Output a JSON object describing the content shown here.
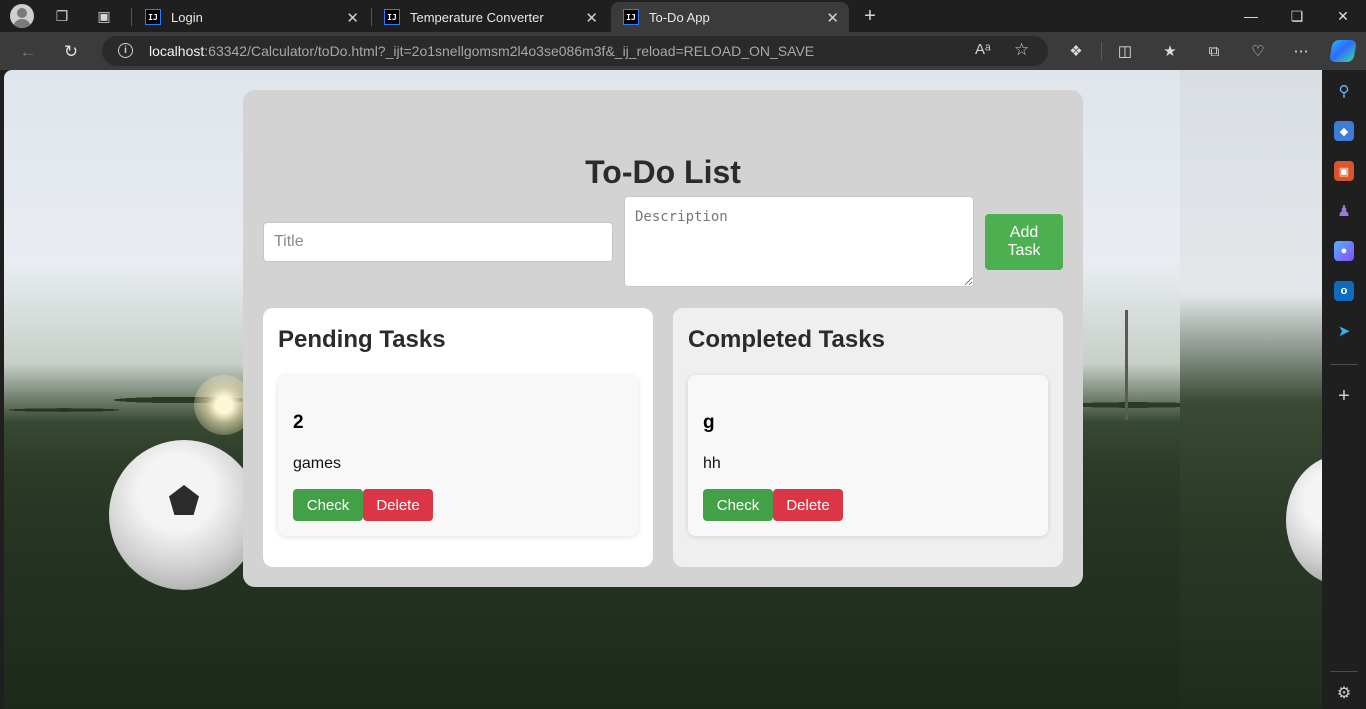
{
  "browser": {
    "tabs": [
      {
        "label": "Login",
        "favicon": "IJ",
        "active": false
      },
      {
        "label": "Temperature Converter",
        "favicon": "IJ",
        "active": false
      },
      {
        "label": "To-Do App",
        "favicon": "IJ",
        "active": true
      }
    ],
    "url_host": "localhost",
    "url_rest": ":63342/Calculator/toDo.html?_ijt=2o1snellgomsm2l4o3se086m3f&_ij_reload=RELOAD_ON_SAVE",
    "read_aloud_icon": "Aᵃ",
    "accent_color": "#2e7bff"
  },
  "app": {
    "title": "To-Do List",
    "title_placeholder": "Title",
    "description_placeholder": "Description",
    "add_button": "Add Task",
    "pending": {
      "heading": "Pending Tasks",
      "tasks": [
        {
          "title": "2",
          "description": "games",
          "check_label": "Check",
          "delete_label": "Delete"
        }
      ]
    },
    "completed": {
      "heading": "Completed Tasks",
      "tasks": [
        {
          "title": "g",
          "description": "hh",
          "check_label": "Check",
          "delete_label": "Delete"
        }
      ]
    },
    "colors": {
      "add": "#4caf50",
      "check": "#43a047",
      "delete": "#dc3545",
      "container": "#d3d3d3"
    }
  }
}
